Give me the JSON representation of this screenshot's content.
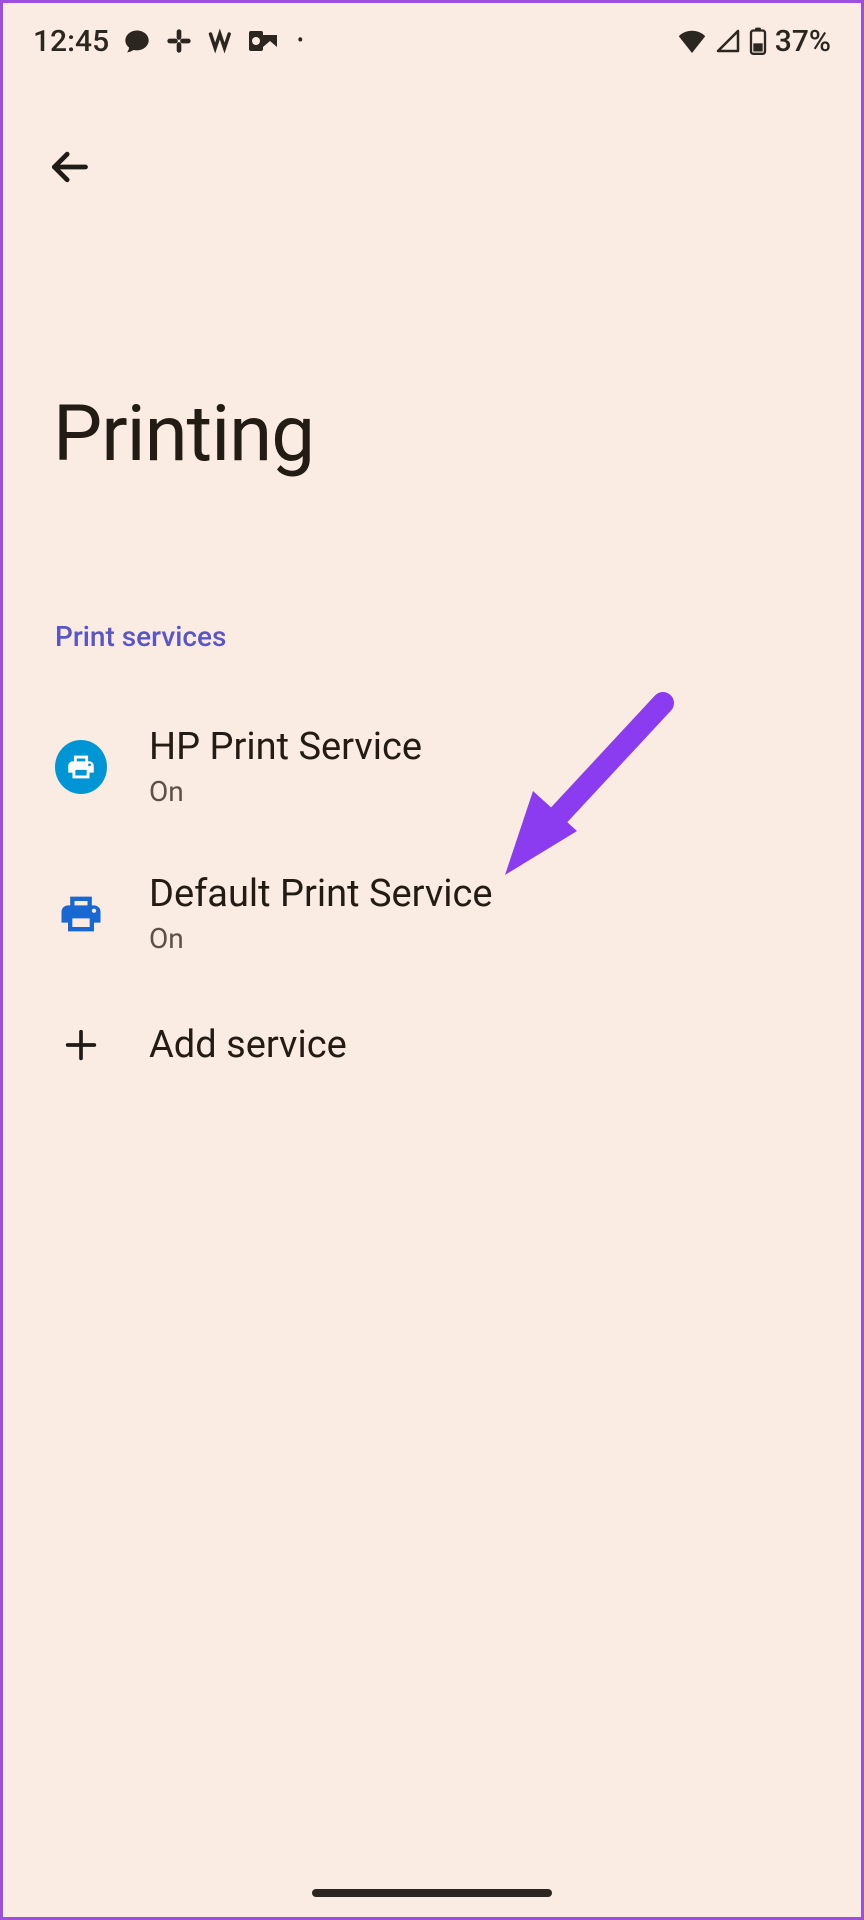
{
  "status": {
    "time": "12:45",
    "battery": "37%"
  },
  "page": {
    "title": "Printing",
    "section_header": "Print services"
  },
  "services": {
    "hp": {
      "title": "HP Print Service",
      "status": "On"
    },
    "default": {
      "title": "Default Print Service",
      "status": "On"
    },
    "add": {
      "title": "Add service"
    }
  }
}
